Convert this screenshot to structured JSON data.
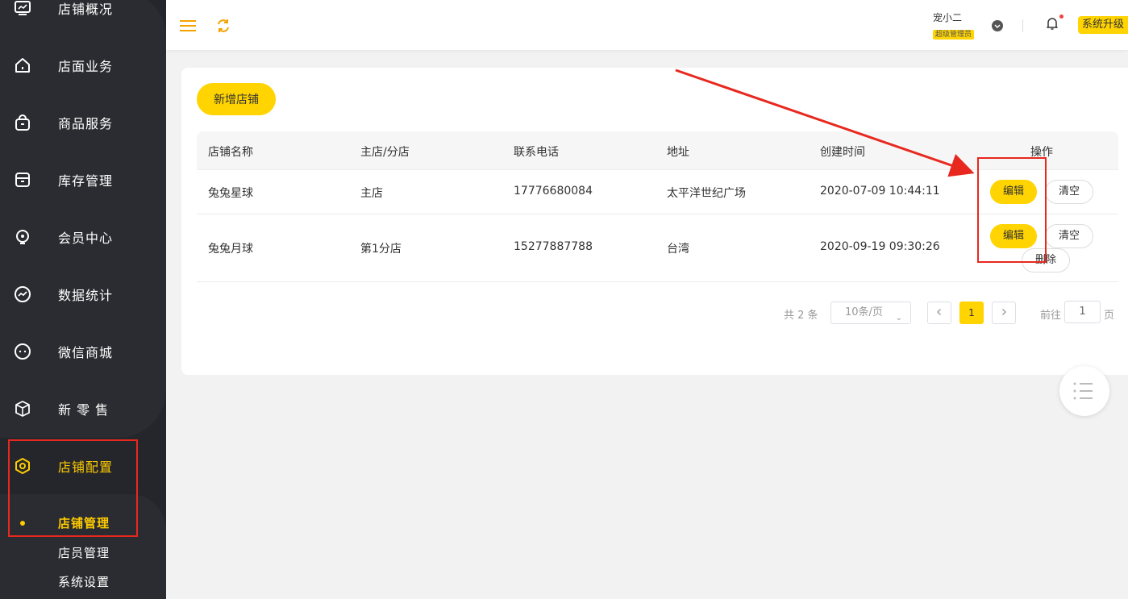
{
  "sidebar": {
    "items": [
      {
        "label": "店铺概况",
        "icon": "monitor-icon"
      },
      {
        "label": "店面业务",
        "icon": "home-icon"
      },
      {
        "label": "商品服务",
        "icon": "bag-icon"
      },
      {
        "label": "库存管理",
        "icon": "box-icon"
      },
      {
        "label": "会员中心",
        "icon": "member-icon"
      },
      {
        "label": "数据统计",
        "icon": "chart-icon"
      },
      {
        "label": "微信商城",
        "icon": "chat-icon"
      },
      {
        "label": "新 零 售",
        "icon": "cube-icon"
      },
      {
        "label": "店铺配置",
        "icon": "settings-hex-icon"
      }
    ],
    "sub_items": [
      "店铺管理",
      "店员管理",
      "系统设置"
    ],
    "accent": "#ffcc00"
  },
  "header": {
    "user_name": "宠小二",
    "user_role": "超级管理员",
    "upgrade_label": "系统升级"
  },
  "main": {
    "add_button": "新增店铺",
    "columns": [
      "店铺名称",
      "主店/分店",
      "联系电话",
      "地址",
      "创建时间",
      "操作"
    ],
    "rows": [
      {
        "name": "兔兔星球",
        "type": "主店",
        "phone": "17776680084",
        "address": "太平洋世纪广场",
        "created": "2020-07-09 10:44:11"
      },
      {
        "name": "兔兔月球",
        "type": "第1分店",
        "phone": "15277887788",
        "address": "台湾",
        "created": "2020-09-19 09:30:26"
      }
    ],
    "actions": {
      "edit": "编辑",
      "clear": "清空",
      "delete": "删除"
    }
  },
  "pagination": {
    "total": "共 2 条",
    "page_size": "10条/页",
    "current_page": "1",
    "goto_label": "前往",
    "goto_value": "1",
    "page_unit": "页"
  }
}
